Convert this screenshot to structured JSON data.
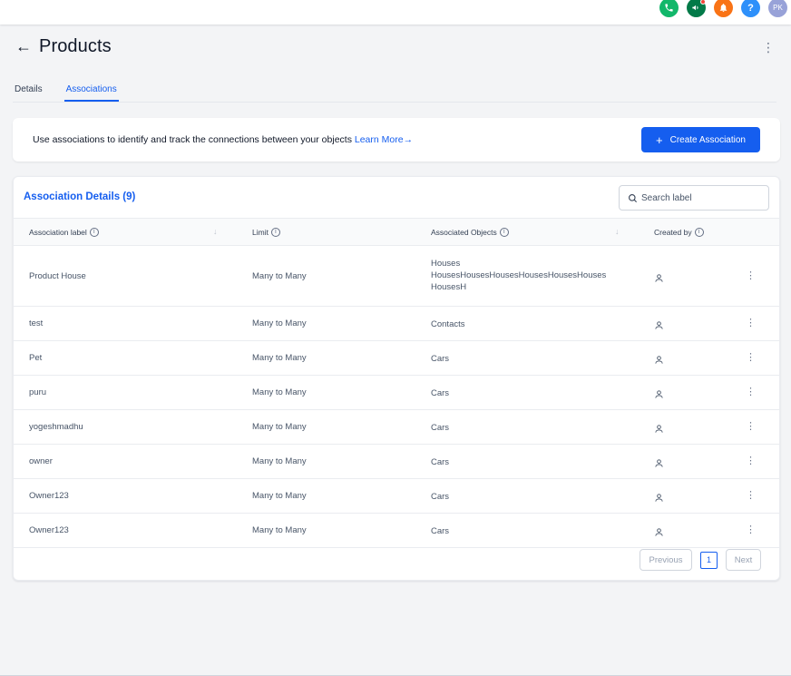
{
  "top_bar": {
    "icons": [
      {
        "name": "phone-icon",
        "color": "#12b76a"
      },
      {
        "name": "megaphone-icon",
        "color": "#027a48",
        "has_badge": true
      },
      {
        "name": "bell-icon",
        "color": "#f97316"
      },
      {
        "name": "help-icon",
        "color": "#2e90fa",
        "glyph": "?"
      }
    ],
    "avatar": {
      "initials": "PK",
      "color": "#98a2d8"
    }
  },
  "page": {
    "title": "Products",
    "back_glyph": "←",
    "menu_glyph": "⋮"
  },
  "tabs": [
    {
      "label": "Details",
      "active": false
    },
    {
      "label": "Associations",
      "active": true
    }
  ],
  "info_banner": {
    "text": "Use associations to identify and track the connections between your objects ",
    "link_label": "Learn More",
    "link_arrow": "→",
    "button_icon": "+",
    "button_label": "Create Association"
  },
  "table": {
    "title": "Association Details (9)",
    "search_placeholder": "Search label",
    "columns": [
      {
        "label": "Association label",
        "info": "i",
        "sortable": true
      },
      {
        "label": "Limit",
        "info": "i",
        "sortable": false
      },
      {
        "label": "Associated Objects",
        "info": "i",
        "sortable": true
      },
      {
        "label": "Created by",
        "info": "i",
        "sortable": false
      }
    ],
    "sort_glyph": "↓",
    "row_menu_glyph": "⋮",
    "rows": [
      {
        "label": "Product House",
        "limit": "Many to Many",
        "objects": [
          "Houses",
          "HousesHousesHousesHousesHousesHouses",
          "HousesH"
        ]
      },
      {
        "label": "test",
        "limit": "Many to Many",
        "objects": [
          "Contacts"
        ]
      },
      {
        "label": "Pet",
        "limit": "Many to Many",
        "objects": [
          "Cars"
        ]
      },
      {
        "label": "puru",
        "limit": "Many to Many",
        "objects": [
          "Cars"
        ]
      },
      {
        "label": "yogeshmadhu",
        "limit": "Many to Many",
        "objects": [
          "Cars"
        ]
      },
      {
        "label": "owner",
        "limit": "Many to Many",
        "objects": [
          "Cars"
        ]
      },
      {
        "label": "Owner123",
        "limit": "Many to Many",
        "objects": [
          "Cars"
        ]
      },
      {
        "label": "Owner123",
        "limit": "Many to Many",
        "objects": [
          "Cars"
        ]
      }
    ]
  },
  "pagination": {
    "previous_label": "Previous",
    "current_page": "1",
    "next_label": "Next"
  },
  "colors": {
    "accent": "#155eef",
    "background": "#f3f4f6"
  }
}
